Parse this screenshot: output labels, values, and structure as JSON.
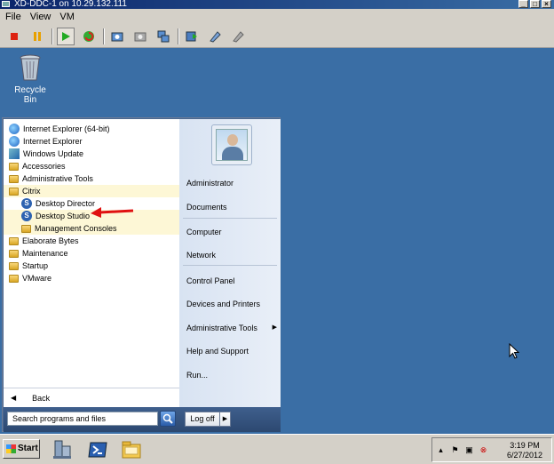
{
  "window": {
    "title": "XD-DDC-1 on 10.29.132.111"
  },
  "menubar": {
    "items": [
      "File",
      "View",
      "VM"
    ]
  },
  "toolbar": {
    "buttons": [
      "stop-icon",
      "pause-icon",
      "play-icon",
      "reset-icon",
      "snapshot-icon",
      "revert-snapshot-icon",
      "manage-snapshots-icon",
      "send-ctrl-alt-del-icon",
      "settings-icon",
      "tools-icon"
    ]
  },
  "desktop": {
    "recycle_bin_label": "Recycle Bin",
    "background": "#3a6ea5"
  },
  "start_menu": {
    "programs": [
      {
        "label": "Internet Explorer (64-bit)",
        "icon": "ie-icon",
        "indent": 0,
        "highlight": false
      },
      {
        "label": "Internet Explorer",
        "icon": "ie-icon",
        "indent": 0,
        "highlight": false
      },
      {
        "label": "Windows Update",
        "icon": "windows-update-icon",
        "indent": 0,
        "highlight": false
      },
      {
        "label": "Accessories",
        "icon": "folder-icon",
        "indent": 0,
        "highlight": false
      },
      {
        "label": "Administrative Tools",
        "icon": "folder-icon",
        "indent": 0,
        "highlight": false
      },
      {
        "label": "Citrix",
        "icon": "folder-icon",
        "indent": 0,
        "highlight": true
      },
      {
        "label": "Desktop Director",
        "icon": "citrix-icon",
        "indent": 1,
        "highlight": false
      },
      {
        "label": "Desktop Studio",
        "icon": "citrix-icon",
        "indent": 1,
        "highlight": true
      },
      {
        "label": "Management Consoles",
        "icon": "folder-icon",
        "indent": 1,
        "highlight": true
      },
      {
        "label": "Elaborate Bytes",
        "icon": "folder-icon",
        "indent": 0,
        "highlight": false
      },
      {
        "label": "Maintenance",
        "icon": "folder-icon",
        "indent": 0,
        "highlight": false
      },
      {
        "label": "Startup",
        "icon": "folder-icon",
        "indent": 0,
        "highlight": false
      },
      {
        "label": "VMware",
        "icon": "folder-icon",
        "indent": 0,
        "highlight": false
      }
    ],
    "back_label": "Back",
    "search_placeholder": "Search programs and files",
    "logoff_label": "Log off",
    "right_items": [
      {
        "label": "Administrator",
        "submenu": false
      },
      {
        "label": "Documents",
        "submenu": false
      },
      {
        "label": "Computer",
        "submenu": false
      },
      {
        "label": "Network",
        "submenu": false
      },
      {
        "label": "Control Panel",
        "submenu": false
      },
      {
        "label": "Devices and Printers",
        "submenu": false
      },
      {
        "label": "Administrative Tools",
        "submenu": true
      },
      {
        "label": "Help and Support",
        "submenu": false
      },
      {
        "label": "Run...",
        "submenu": false
      }
    ]
  },
  "taskbar": {
    "start_label": "Start",
    "apps": [
      "server-manager-icon",
      "powershell-icon",
      "explorer-icon"
    ],
    "tray_icons": [
      "show-hidden-icons-icon",
      "action-center-flag-icon",
      "network-icon",
      "volume-muted-icon"
    ],
    "clock_time": "3:19 PM",
    "clock_date": "6/27/2012"
  }
}
